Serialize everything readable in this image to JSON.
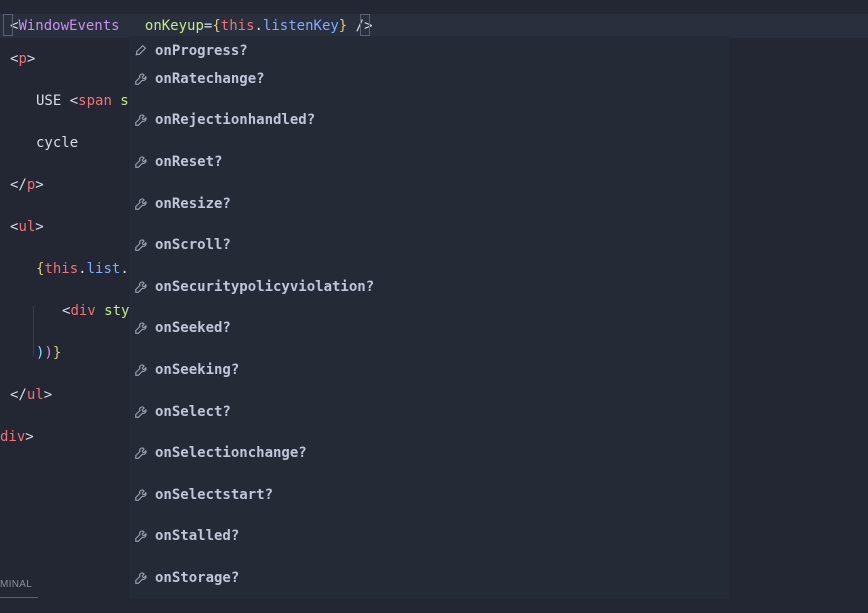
{
  "editor": {
    "lines": [
      {
        "indent": 0,
        "tokens": [
          {
            "t": "<",
            "c": "tok-punct"
          },
          {
            "t": "WindowEvents",
            "c": "tok-component"
          },
          {
            "t": "   ",
            "c": ""
          },
          {
            "t": "onKeyup",
            "c": "tok-attr"
          },
          {
            "t": "=",
            "c": "tok-punct"
          },
          {
            "t": "{",
            "c": "tok-bracket1"
          },
          {
            "t": "this",
            "c": "tok-tag"
          },
          {
            "t": ".",
            "c": "tok-punct"
          },
          {
            "t": "listenKey",
            "c": "tok-prop"
          },
          {
            "t": "}",
            "c": "tok-bracket1"
          },
          {
            "t": " /",
            "c": "tok-punct"
          },
          {
            "t": ">",
            "c": "tok-punct"
          }
        ]
      },
      {
        "indent": 0,
        "tokens": [
          {
            "t": "<",
            "c": "tok-punct"
          },
          {
            "t": "p",
            "c": "tok-tag"
          },
          {
            "t": ">",
            "c": "tok-punct"
          }
        ]
      },
      {
        "indent": 1,
        "tokens": [
          {
            "t": "USE ",
            "c": "tok-text"
          },
          {
            "t": "<",
            "c": "tok-punct"
          },
          {
            "t": "span",
            "c": "tok-tag"
          },
          {
            "t": " s",
            "c": "tok-attr"
          }
        ]
      },
      {
        "indent": 1,
        "tokens": [
          {
            "t": "cycle",
            "c": "tok-text"
          }
        ]
      },
      {
        "indent": 0,
        "tokens": [
          {
            "t": "</",
            "c": "tok-punct"
          },
          {
            "t": "p",
            "c": "tok-tag"
          },
          {
            "t": ">",
            "c": "tok-punct"
          }
        ]
      },
      {
        "indent": 0,
        "tokens": [
          {
            "t": "<",
            "c": "tok-punct"
          },
          {
            "t": "ul",
            "c": "tok-tag"
          },
          {
            "t": ">",
            "c": "tok-punct"
          }
        ]
      },
      {
        "indent": 1,
        "tokens": [
          {
            "t": "{",
            "c": "tok-bracket1"
          },
          {
            "t": "this",
            "c": "tok-tag"
          },
          {
            "t": ".",
            "c": "tok-punct"
          },
          {
            "t": "list",
            "c": "tok-prop"
          },
          {
            "t": ".",
            "c": "tok-punct"
          }
        ]
      },
      {
        "indent": 2,
        "tokens": [
          {
            "t": "<",
            "c": "tok-punct"
          },
          {
            "t": "div",
            "c": "tok-tag"
          },
          {
            "t": " sty",
            "c": "tok-attr"
          }
        ]
      },
      {
        "indent": 1,
        "tokens": [
          {
            "t": ")",
            "c": "tok-bracket3"
          },
          {
            "t": ")",
            "c": "tok-bracket2"
          },
          {
            "t": "}",
            "c": "tok-bracket1"
          }
        ]
      },
      {
        "indent": 0,
        "tokens": [
          {
            "t": "</",
            "c": "tok-punct"
          },
          {
            "t": "ul",
            "c": "tok-tag"
          },
          {
            "t": ">",
            "c": "tok-punct"
          }
        ]
      },
      {
        "indent": -1,
        "tokens": [
          {
            "t": "div",
            "c": "tok-tag"
          },
          {
            "t": ">",
            "c": "tok-punct"
          }
        ]
      }
    ]
  },
  "suggestions": {
    "truncated_first": "onProgress?",
    "items": [
      "onRatechange?",
      "onRejectionhandled?",
      "onReset?",
      "onResize?",
      "onScroll?",
      "onSecuritypolicyviolation?",
      "onSeeked?",
      "onSeeking?",
      "onSelect?",
      "onSelectionchange?",
      "onSelectstart?",
      "onStalled?",
      "onStorage?"
    ]
  },
  "panel": {
    "tab_terminal": "MINAL"
  }
}
